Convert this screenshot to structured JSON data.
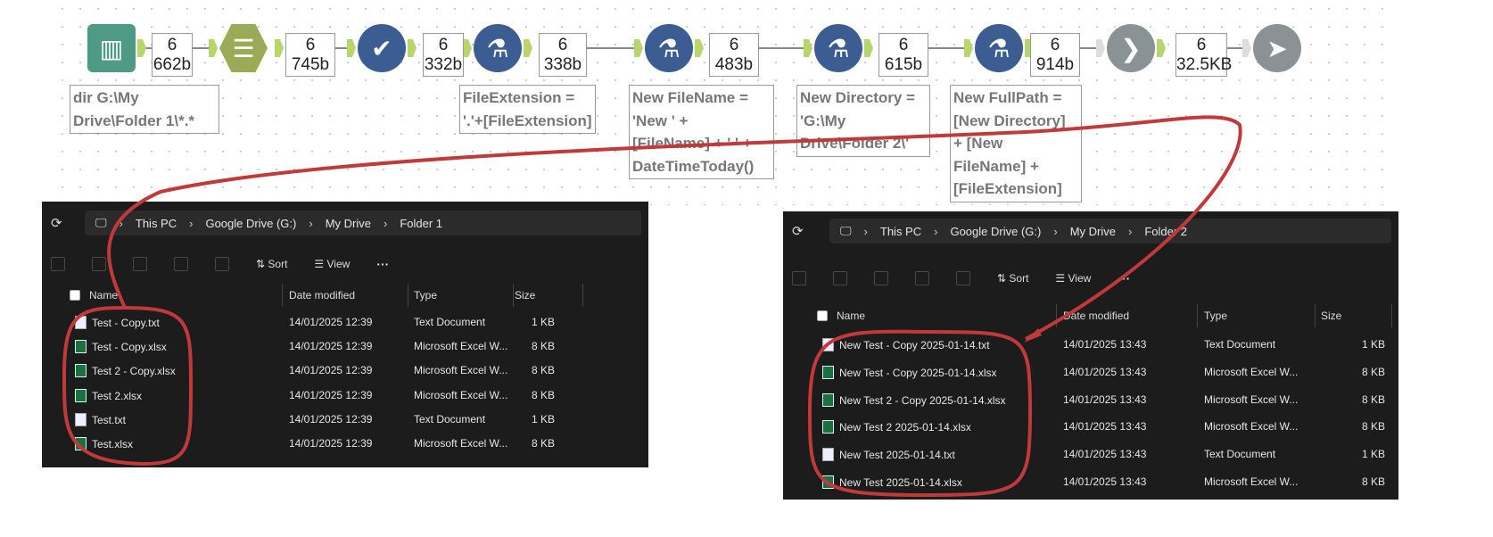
{
  "workflow": {
    "tools": [
      {
        "name": "directory-tool",
        "color": "#4e9a84"
      },
      {
        "name": "select-tool",
        "color": "#9aab57"
      },
      {
        "name": "test-tool",
        "color": "#3c5d92"
      },
      {
        "name": "formula-tool",
        "color": "#3c5d92"
      },
      {
        "name": "formula-tool",
        "color": "#3c5d92"
      },
      {
        "name": "formula-tool",
        "color": "#3c5d92"
      },
      {
        "name": "formula-tool",
        "color": "#3c5d92"
      },
      {
        "name": "run-command-tool",
        "color": "#8a9296"
      },
      {
        "name": "output-tool",
        "color": "#8a9296"
      }
    ],
    "counts": [
      {
        "records": "6",
        "size": "662b"
      },
      {
        "records": "6",
        "size": "745b"
      },
      {
        "records": "6",
        "size": "332b"
      },
      {
        "records": "6",
        "size": "338b"
      },
      {
        "records": "6",
        "size": "483b"
      },
      {
        "records": "6",
        "size": "615b"
      },
      {
        "records": "6",
        "size": "914b"
      },
      {
        "records": "6",
        "size": "32.5KB"
      }
    ],
    "annotations": [
      "dir G:\\My\nDrive\\Folder 1\\*.*",
      "FileExtension =\n'.'+[FileExtension]",
      "New FileName =\n'New ' +\n[FileName] + ' ' +\nDateTimeToday()",
      "New Directory =\n'G:\\My\nDrive\\Folder 2\\'",
      "New FullPath =\n[New Directory]\n+ [New\nFileName] +\n[FileExtension]"
    ]
  },
  "explorer_left": {
    "breadcrumb": [
      "This PC",
      "Google Drive (G:)",
      "My Drive",
      "Folder 1"
    ],
    "toolbar": {
      "sort": "Sort",
      "view": "View",
      "more": "···"
    },
    "columns": [
      "Name",
      "Date modified",
      "Type",
      "Size"
    ],
    "files": [
      {
        "name": "Test - Copy.txt",
        "date": "14/01/2025 12:39",
        "type": "Text Document",
        "size": "1 KB",
        "kind": "txt"
      },
      {
        "name": "Test - Copy.xlsx",
        "date": "14/01/2025 12:39",
        "type": "Microsoft Excel W...",
        "size": "8 KB",
        "kind": "xlsx"
      },
      {
        "name": "Test 2 - Copy.xlsx",
        "date": "14/01/2025 12:39",
        "type": "Microsoft Excel W...",
        "size": "8 KB",
        "kind": "xlsx"
      },
      {
        "name": "Test 2.xlsx",
        "date": "14/01/2025 12:39",
        "type": "Microsoft Excel W...",
        "size": "8 KB",
        "kind": "xlsx"
      },
      {
        "name": "Test.txt",
        "date": "14/01/2025 12:39",
        "type": "Text Document",
        "size": "1 KB",
        "kind": "txt"
      },
      {
        "name": "Test.xlsx",
        "date": "14/01/2025 12:39",
        "type": "Microsoft Excel W...",
        "size": "8 KB",
        "kind": "xlsx"
      }
    ]
  },
  "explorer_right": {
    "breadcrumb": [
      "This PC",
      "Google Drive (G:)",
      "My Drive",
      "Folder 2"
    ],
    "toolbar": {
      "sort": "Sort",
      "view": "View",
      "more": "···"
    },
    "columns": [
      "Name",
      "Date modified",
      "Type",
      "Size"
    ],
    "files": [
      {
        "name": "New Test - Copy 2025-01-14.txt",
        "date": "14/01/2025 13:43",
        "type": "Text Document",
        "size": "1 KB",
        "kind": "txt"
      },
      {
        "name": "New Test - Copy 2025-01-14.xlsx",
        "date": "14/01/2025 13:43",
        "type": "Microsoft Excel W...",
        "size": "8 KB",
        "kind": "xlsx"
      },
      {
        "name": "New Test 2 - Copy 2025-01-14.xlsx",
        "date": "14/01/2025 13:43",
        "type": "Microsoft Excel W...",
        "size": "8 KB",
        "kind": "xlsx"
      },
      {
        "name": "New Test 2 2025-01-14.xlsx",
        "date": "14/01/2025 13:43",
        "type": "Microsoft Excel W...",
        "size": "8 KB",
        "kind": "xlsx"
      },
      {
        "name": "New Test 2025-01-14.txt",
        "date": "14/01/2025 13:43",
        "type": "Text Document",
        "size": "1 KB",
        "kind": "txt"
      },
      {
        "name": "New Test 2025-01-14.xlsx",
        "date": "14/01/2025 13:43",
        "type": "Microsoft Excel W...",
        "size": "8 KB",
        "kind": "xlsx"
      }
    ]
  },
  "annotation_color": "#c0393b"
}
